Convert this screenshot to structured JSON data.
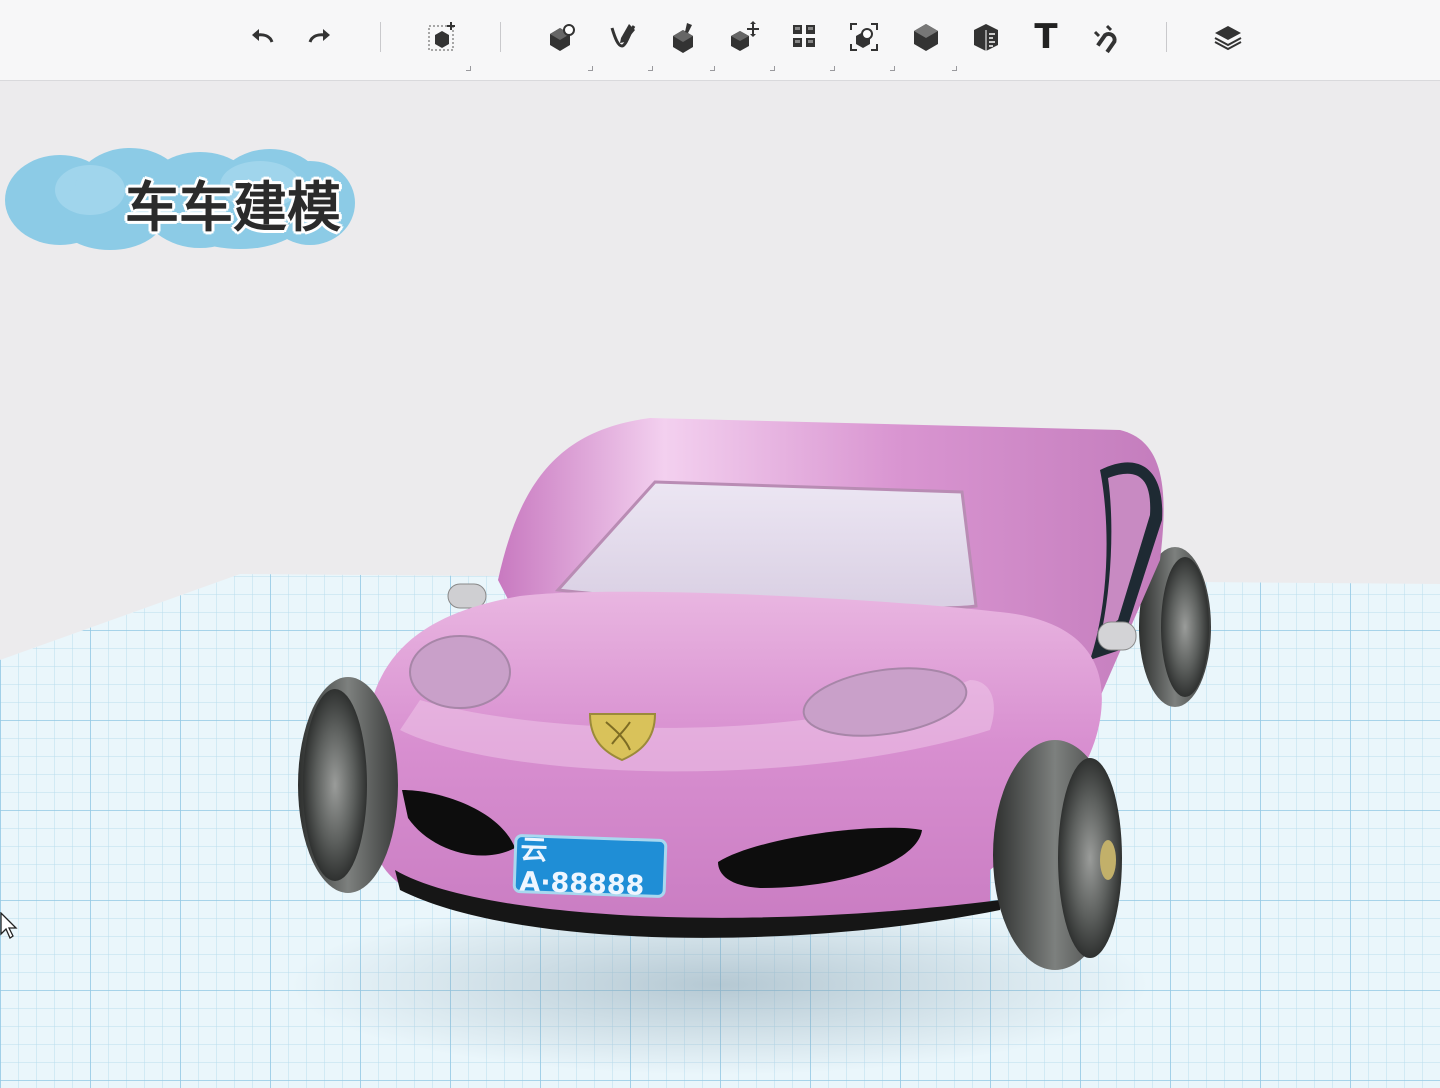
{
  "toolbar": {
    "buttons": [
      {
        "name": "undo-icon"
      },
      {
        "name": "redo-icon"
      },
      {
        "name": "add-primitive-icon"
      },
      {
        "name": "sketch-icon"
      },
      {
        "name": "edit-curve-icon"
      },
      {
        "name": "paint-icon"
      },
      {
        "name": "move-icon"
      },
      {
        "name": "pattern-icon"
      },
      {
        "name": "group-icon"
      },
      {
        "name": "solid-icon"
      },
      {
        "name": "measure-icon"
      },
      {
        "name": "text-icon",
        "label": "T"
      },
      {
        "name": "magnet-icon"
      },
      {
        "name": "material-icon"
      }
    ]
  },
  "overlay": {
    "title": "车车建模"
  },
  "model": {
    "license_plate": "云A·88888",
    "body_color": "#d998d0",
    "tire_color": "#4a4d4b",
    "grid_color": "#a6d3ea"
  }
}
